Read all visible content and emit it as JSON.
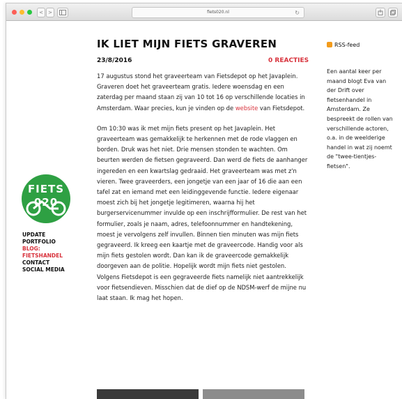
{
  "browser": {
    "url": "fiets020.nl",
    "back_label": "<",
    "forward_label": ">",
    "traffic_lights": {
      "close": "#fc5f57",
      "minimize": "#fdbc2e",
      "zoom": "#28c840"
    }
  },
  "logo": {
    "text": "FIETS020",
    "color": "#2ea043"
  },
  "nav": {
    "items": [
      {
        "label": "UPDATE"
      },
      {
        "label": "PORTFOLIO"
      },
      {
        "label": "BLOG: FIETSHANDEL"
      },
      {
        "label": "CONTACT"
      },
      {
        "label": "SOCIAL MEDIA"
      }
    ]
  },
  "article": {
    "title": "IK LIET MIJN FIETS GRAVEREN",
    "date": "23/8/2016",
    "reactions": "0 REACTIES",
    "p1_before_link": "17 augustus  stond  het graveerteam van Fietsdepot op het Javaplein. Graveren doet het graveerteam gratis.  Iedere woensdag en een zaterdag per maand staan zij van 10 tot 16 op verschillende  locaties in Amsterdam. Waar precies, kun je vinden op de ",
    "p1_link": "website",
    "p1_after_link": " van Fietsdepot.",
    "p2": "Om  10:30 was ik met mijn fiets present op het Javaplein. Het graveerteam was gemakkelijk te herkennen met de rode  vlaggen en borden.  Druk was het niet. Drie mensen stonden te wachten. Om beurten werden de  fietsen  gegraveerd. Dan werd de fiets de aanhanger ingereden en een kwartslag gedraaid. Het graveerteam was met z'n vieren. Twee graveerders, een jongetje van een jaar of 16  die aan  een tafel zat  en iemand met een leidinggevende functie.  Iedere  eigenaar moest zich bij  het jongetje legitimeren, waarna hij het burgerservicenummer invulde op een  inschrijfformulier. De rest van het formulier, zoals  je naam,  adres, telefoonnummer en  handtekening, moest je vervolgens zelf invullen.  Binnen tien minuten was mijn fiets gegraveerd. Ik kreeg een kaartje met de graveercode. Handig voor als mijn fiets gestolen wordt. Dan kan ik de  graveercode gemakkelijk doorgeven aan  de politie. Hopelijk wordt mijn fiets niet gestolen.   Volgens Fietsdepot is een gegraveerde fiets namelijk niet  aantrekkelijk voor fietsendieven.  Misschien dat de dief op de NDSM-werf de mijne nu laat staan. Ik mag het hopen."
  },
  "sidebar": {
    "heading": "RSS-feed",
    "text": "Een aantal keer per maand blogt Eva van der Drift over fietsenhandel in Amsterdam. Ze bespreekt de rollen van verschillende actoren, o.a.  in de weelderige handel in wat zij noemt de \"twee-tientjes-fietsen\"."
  },
  "colors": {
    "accent": "#d8323c",
    "brand_green": "#2ea043"
  }
}
